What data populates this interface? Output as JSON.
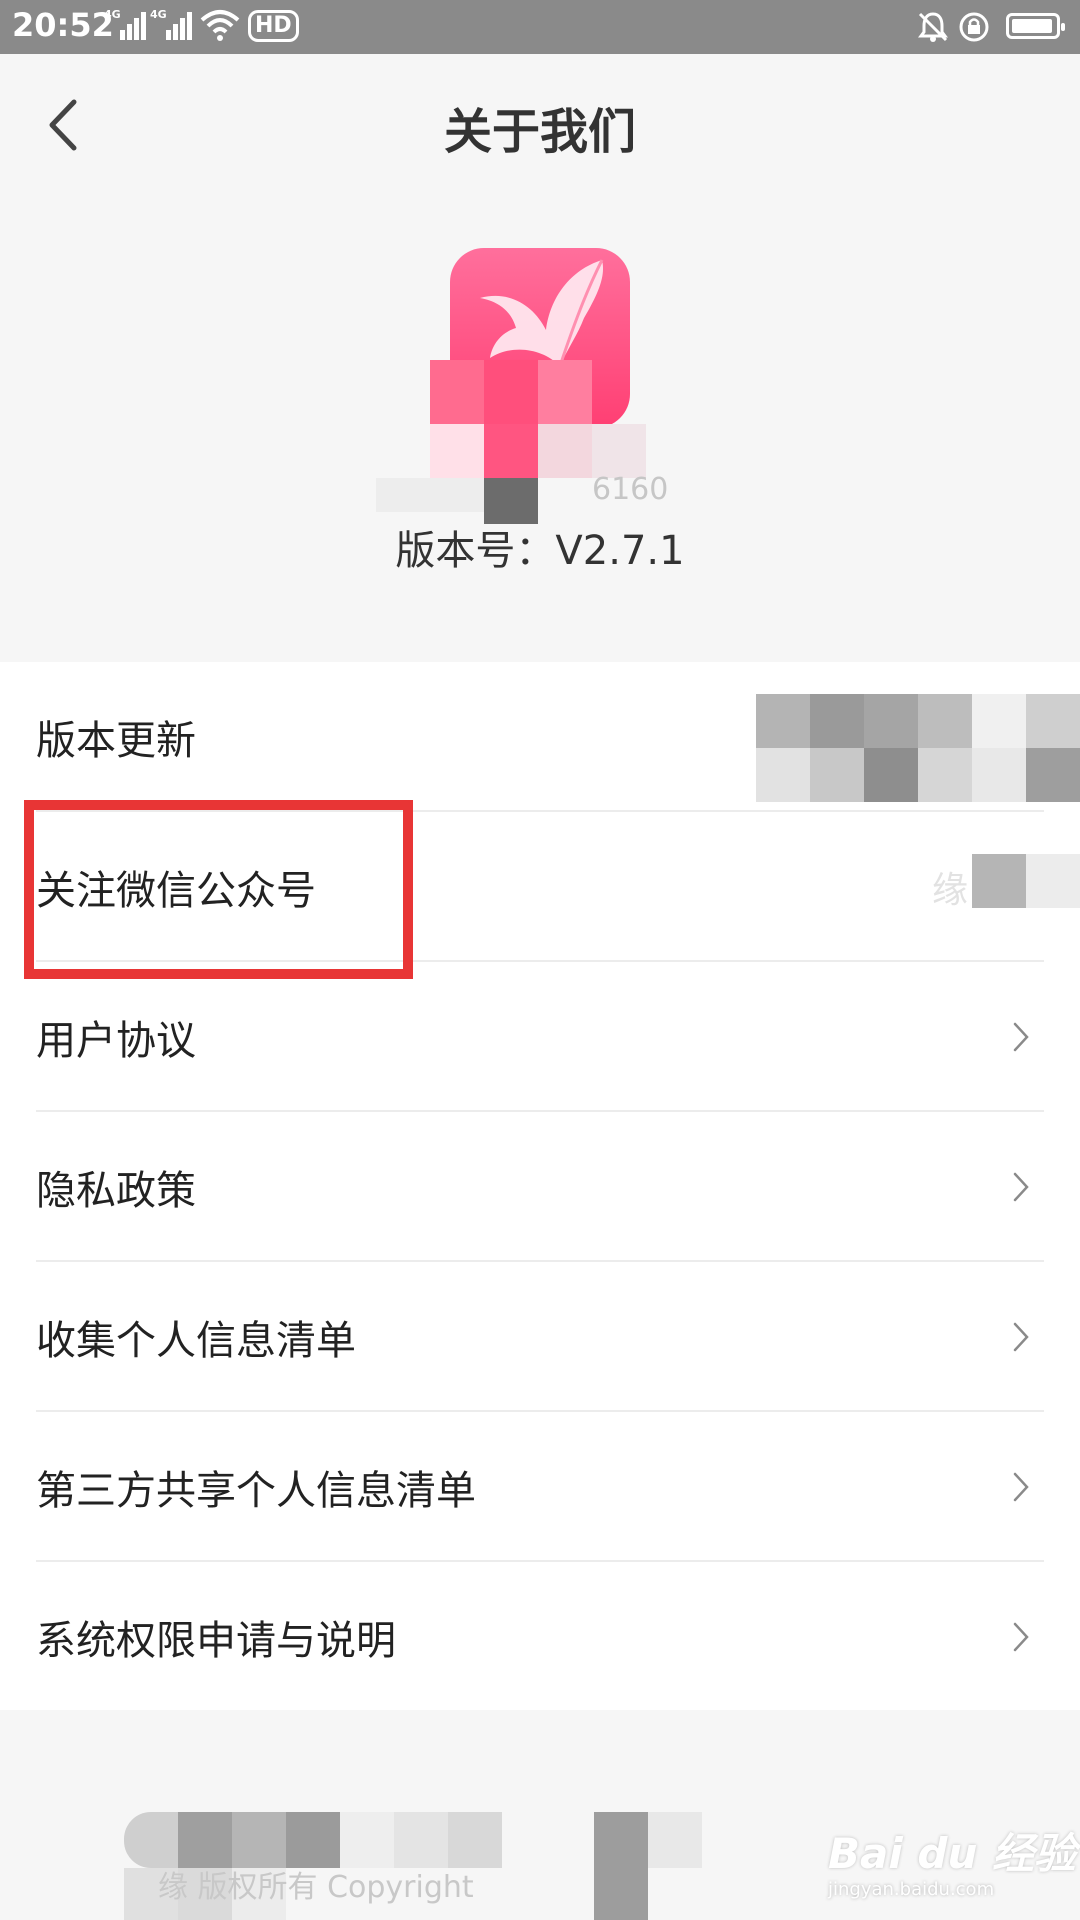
{
  "status_bar": {
    "time": "20:52",
    "network_1": "4G",
    "network_2": "4G",
    "hd_label": "HD",
    "icons": [
      "signal-icon",
      "wifi-icon",
      "hd-icon",
      "bell-mute-icon",
      "rotation-lock-icon",
      "battery-icon"
    ]
  },
  "header": {
    "title": "关于我们",
    "back_icon": "chevron-left-icon"
  },
  "app_info": {
    "logo": "app-logo-bird",
    "app_id_partial": "6160",
    "version": "版本号：V2.7.1"
  },
  "menu": {
    "items": [
      {
        "label": "版本更新",
        "chevron": false
      },
      {
        "label": "关注微信公众号",
        "value_partial": "缘",
        "chevron": false
      },
      {
        "label": "用户协议",
        "chevron": true
      },
      {
        "label": "隐私政策",
        "chevron": true
      },
      {
        "label": "收集个人信息清单",
        "chevron": true
      },
      {
        "label": "第三方共享个人信息清单",
        "chevron": true
      },
      {
        "label": "系统权限申请与说明",
        "chevron": true
      }
    ]
  },
  "footer": {
    "copyright_partial": "缘    版权所有 Copyright"
  },
  "watermark": {
    "logo": "Bai du 经验",
    "url": "jingyan.baidu.com"
  },
  "colors": {
    "brand_pink": "#ff4a7d",
    "highlight_red": "#e83535",
    "status_bar": "#8a8a8a"
  }
}
